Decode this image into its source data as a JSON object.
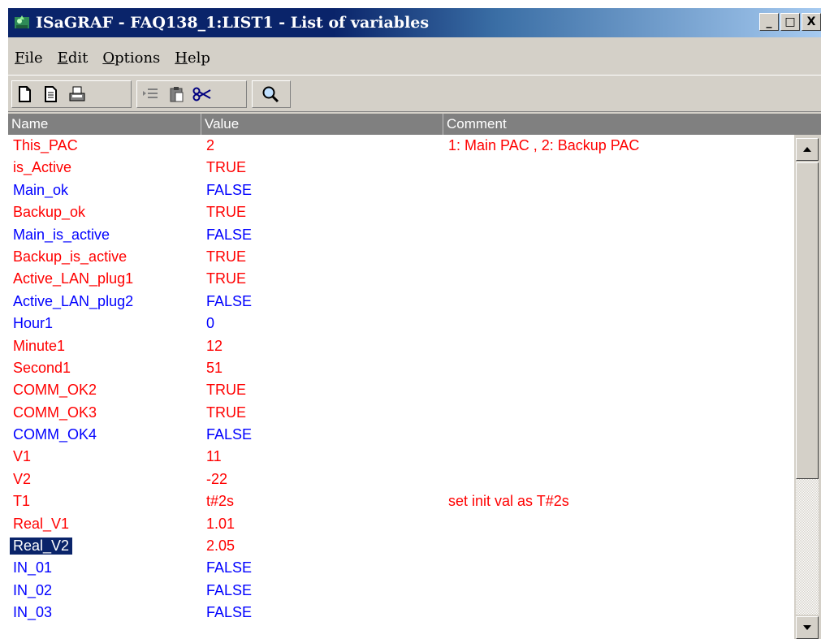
{
  "window": {
    "title": "ISaGRAF - FAQ138_1:LIST1 - List of variables",
    "controls": {
      "minimize": "_",
      "maximize": "□",
      "close": "X"
    }
  },
  "menu": {
    "items": [
      {
        "label": "File",
        "key": "F"
      },
      {
        "label": "Edit",
        "key": "E"
      },
      {
        "label": "Options",
        "key": "O"
      },
      {
        "label": "Help",
        "key": "H"
      }
    ]
  },
  "toolbar": {
    "buttons": [
      "new-document-icon",
      "open-document-icon",
      "print-icon",
      "insert-line-icon",
      "paste-icon",
      "cut-icon",
      "search-icon"
    ]
  },
  "columns": {
    "name": "Name",
    "value": "Value",
    "comment": "Comment"
  },
  "colors": {
    "red": "#ff0000",
    "blue": "#0000ff",
    "selection": "#0a246a"
  },
  "rows": [
    {
      "name": "This_PAC",
      "value": "2",
      "comment": "1: Main PAC , 2: Backup PAC",
      "color": "red"
    },
    {
      "name": "is_Active",
      "value": "TRUE",
      "comment": "",
      "color": "red"
    },
    {
      "name": "Main_ok",
      "value": "FALSE",
      "comment": "",
      "color": "blue"
    },
    {
      "name": "Backup_ok",
      "value": "TRUE",
      "comment": "",
      "color": "red"
    },
    {
      "name": "Main_is_active",
      "value": "FALSE",
      "comment": "",
      "color": "blue"
    },
    {
      "name": "Backup_is_active",
      "value": "TRUE",
      "comment": "",
      "color": "red"
    },
    {
      "name": "Active_LAN_plug1",
      "value": "TRUE",
      "comment": "",
      "color": "red"
    },
    {
      "name": "Active_LAN_plug2",
      "value": "FALSE",
      "comment": "",
      "color": "blue"
    },
    {
      "name": "Hour1",
      "value": "0",
      "comment": "",
      "color": "blue"
    },
    {
      "name": "Minute1",
      "value": "12",
      "comment": "",
      "color": "red"
    },
    {
      "name": "Second1",
      "value": "51",
      "comment": "",
      "color": "red"
    },
    {
      "name": "COMM_OK2",
      "value": "TRUE",
      "comment": "",
      "color": "red"
    },
    {
      "name": "COMM_OK3",
      "value": "TRUE",
      "comment": "",
      "color": "red"
    },
    {
      "name": "COMM_OK4",
      "value": "FALSE",
      "comment": "",
      "color": "blue"
    },
    {
      "name": "V1",
      "value": "11",
      "comment": "",
      "color": "red"
    },
    {
      "name": "V2",
      "value": "-22",
      "comment": "",
      "color": "red"
    },
    {
      "name": "T1",
      "value": "t#2s",
      "comment": "set init val as T#2s",
      "color": "red"
    },
    {
      "name": "Real_V1",
      "value": "1.01",
      "comment": "",
      "color": "red"
    },
    {
      "name": "Real_V2",
      "value": "2.05",
      "comment": "",
      "color": "red",
      "selected": true
    },
    {
      "name": "IN_01",
      "value": "FALSE",
      "comment": "",
      "color": "blue"
    },
    {
      "name": "IN_02",
      "value": "FALSE",
      "comment": "",
      "color": "blue"
    },
    {
      "name": "IN_03",
      "value": "FALSE",
      "comment": "",
      "color": "blue"
    }
  ]
}
